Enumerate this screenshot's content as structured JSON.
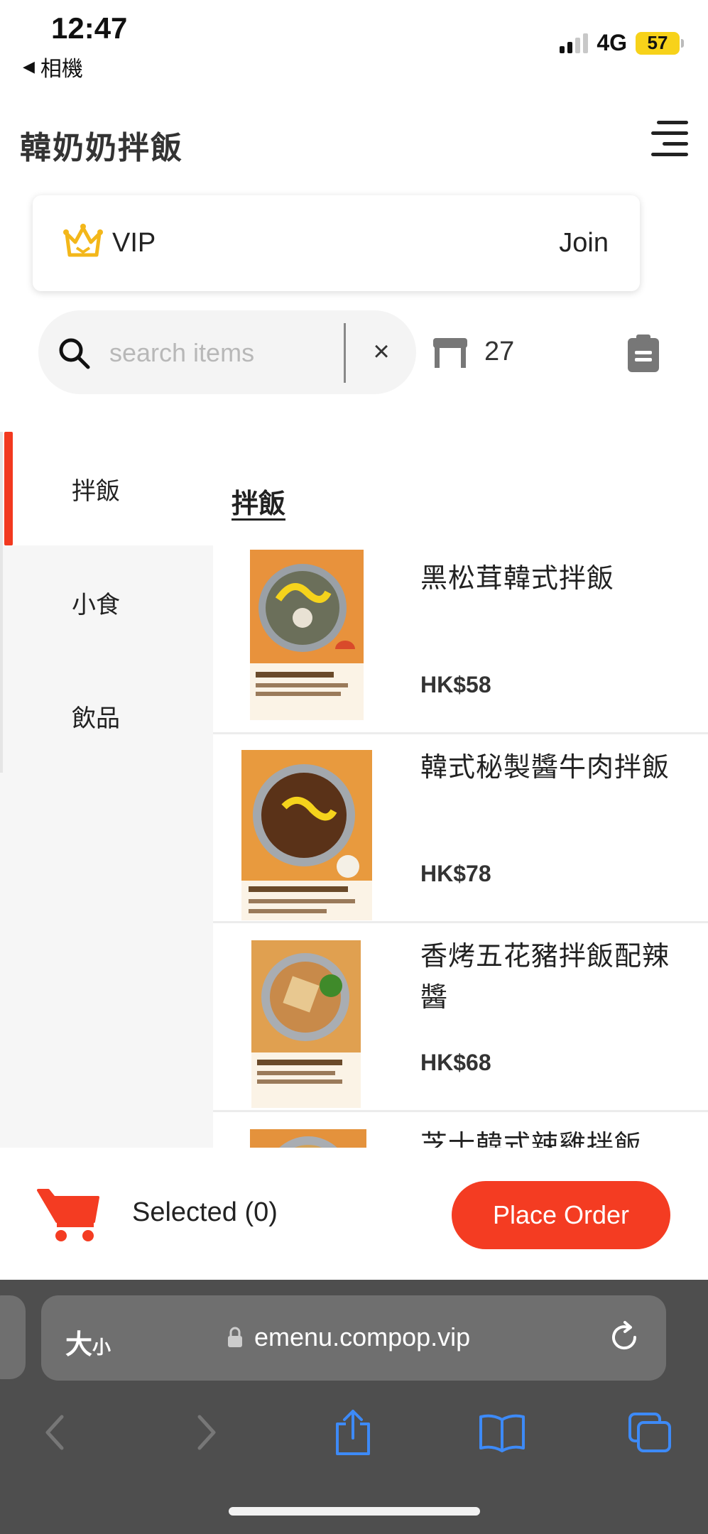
{
  "status_bar": {
    "time": "12:47",
    "back_label": "相機",
    "network": "4G",
    "battery": "57"
  },
  "header": {
    "title": "韓奶奶拌飯",
    "menu_icon": "hamburger-icon"
  },
  "vip": {
    "label": "VIP",
    "join_label": "Join",
    "icon": "crown-icon",
    "icon_color": "#f3b71a"
  },
  "search": {
    "placeholder": "search items",
    "value": "",
    "clear_label": "×"
  },
  "table": {
    "number": "27",
    "icon": "table-icon"
  },
  "categories": [
    {
      "label": "拌飯",
      "active": true
    },
    {
      "label": "小食",
      "active": false
    },
    {
      "label": "飲品",
      "active": false
    }
  ],
  "section": {
    "title": "拌飯"
  },
  "items": [
    {
      "name": "黑松茸韓式拌飯",
      "price": "HK$58"
    },
    {
      "name": "韓式秘製醬牛肉拌飯",
      "price": "HK$78"
    },
    {
      "name": "香烤五花豬拌飯配辣醬",
      "price": "HK$68"
    },
    {
      "name": "芝士韓式辣雞拌飯",
      "price": ""
    }
  ],
  "order_bar": {
    "selected_label": "Selected (0)",
    "place_order_label": "Place Order",
    "accent_color": "#f43c22"
  },
  "browser": {
    "text_size_label": "大",
    "text_size_small": "小",
    "url": "emenu.compop.vip"
  }
}
